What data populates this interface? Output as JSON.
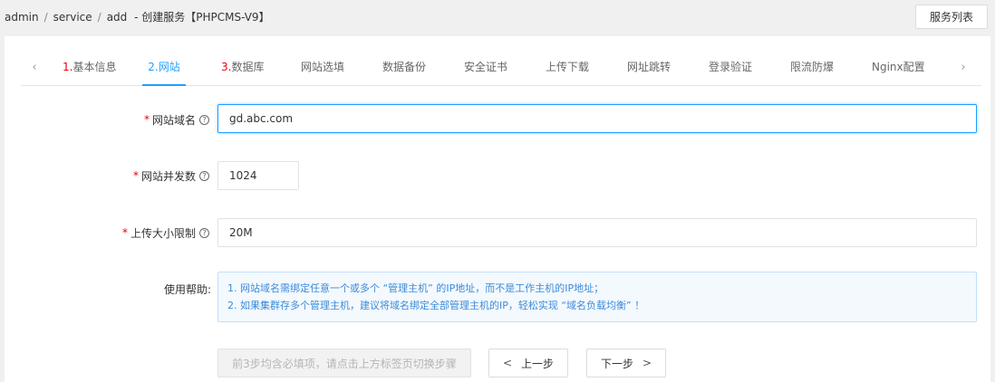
{
  "breadcrumb": {
    "items": [
      "admin",
      "service",
      "add"
    ],
    "separator": "/",
    "title": "- 创建服务【PHPCMS-V9】"
  },
  "header": {
    "list_button": "服务列表"
  },
  "tabs": [
    {
      "num": "1.",
      "label": "基本信息",
      "active": false
    },
    {
      "num": "2.",
      "label": "网站",
      "active": true
    },
    {
      "num": "3.",
      "label": "数据库",
      "active": false
    },
    {
      "num": "",
      "label": "网站选填",
      "active": false
    },
    {
      "num": "",
      "label": "数据备份",
      "active": false
    },
    {
      "num": "",
      "label": "安全证书",
      "active": false
    },
    {
      "num": "",
      "label": "上传下载",
      "active": false
    },
    {
      "num": "",
      "label": "网址跳转",
      "active": false
    },
    {
      "num": "",
      "label": "登录验证",
      "active": false
    },
    {
      "num": "",
      "label": "限流防爆",
      "active": false
    },
    {
      "num": "",
      "label": "Nginx配置",
      "active": false
    }
  ],
  "form": {
    "domain": {
      "required": "*",
      "label": "网站域名",
      "value": "gd.abc.com"
    },
    "concurrency": {
      "required": "*",
      "label": "网站并发数",
      "value": "1024"
    },
    "upload_limit": {
      "required": "*",
      "label": "上传大小限制",
      "value": "20M"
    },
    "help": {
      "label": "使用帮助:",
      "lines": [
        "1. 网站域名需绑定任意一个或多个 “管理主机” 的IP地址，而不是工作主机的IP地址；",
        "2. 如果集群存多个管理主机，建议将域名绑定全部管理主机的IP，轻松实现 “域名负载均衡” ！"
      ]
    }
  },
  "actions": {
    "hint": "前3步均含必填项，请点击上方标签页切换步骤",
    "prev": "上一步",
    "next": "下一步"
  },
  "colors": {
    "accent": "#1e9fff",
    "required": "#e8000b",
    "help_text": "#3a8bd8"
  }
}
